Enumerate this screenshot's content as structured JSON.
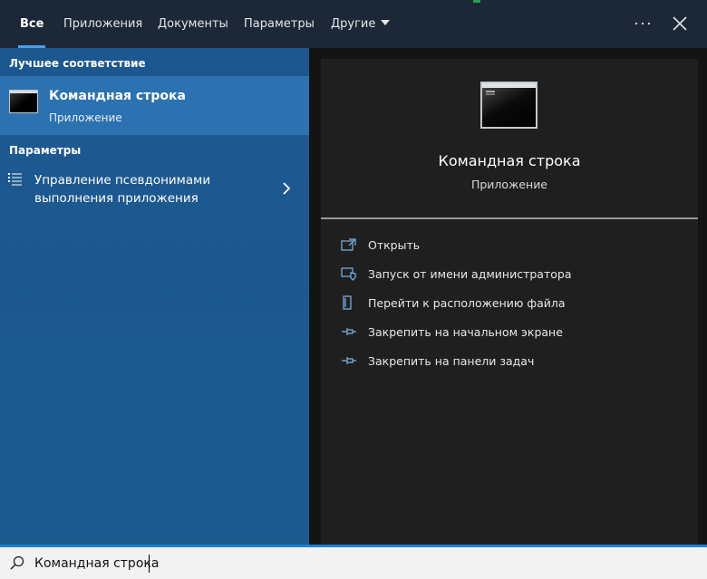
{
  "tabs": [
    {
      "label": "Все",
      "active": true
    },
    {
      "label": "Приложения"
    },
    {
      "label": "Документы"
    },
    {
      "label": "Параметры"
    },
    {
      "label": "Другие",
      "has_dropdown": true
    }
  ],
  "topbar": {
    "more_icon": "more-dots-icon",
    "close_icon": "close-icon"
  },
  "best_match": {
    "heading": "Лучшее соответствие",
    "title": "Командная строка",
    "subtitle": "Приложение",
    "icon": "command-prompt-icon"
  },
  "settings": {
    "heading": "Параметры",
    "items": [
      {
        "label": "Управление псевдонимами выполнения приложения",
        "icon": "settings-list-icon"
      }
    ]
  },
  "preview": {
    "title": "Командная строка",
    "subtitle": "Приложение",
    "actions": [
      {
        "label": "Открыть",
        "icon": "open-icon"
      },
      {
        "label": "Запуск от имени администратора",
        "icon": "admin-shield-icon"
      },
      {
        "label": "Перейти к расположению файла",
        "icon": "file-location-icon"
      },
      {
        "label": "Закрепить на начальном экране",
        "icon": "pin-icon"
      },
      {
        "label": "Закрепить на панели задач",
        "icon": "pin-icon"
      }
    ]
  },
  "search": {
    "value": "Командная строка"
  },
  "colors": {
    "accent": "#1a82d6",
    "topbar": "#1c2838",
    "left_panel": "#1c5a8f",
    "selected": "#2d72b0",
    "right_panel": "#1f1f1f"
  }
}
